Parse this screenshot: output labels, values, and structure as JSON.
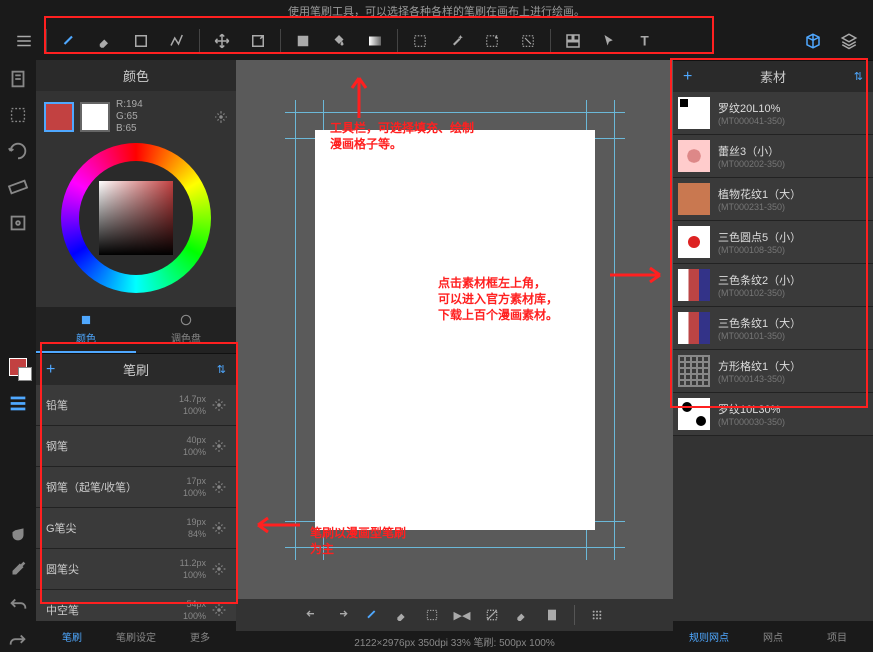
{
  "top_tip": "使用笔刷工具，可以选择各种各样的笔刷在画布上进行绘画。",
  "left_panel": {
    "color_title": "颜色",
    "rgb": {
      "r": "R:194",
      "g": "G:65",
      "b": "B:65"
    },
    "tabs": {
      "color": "颜色",
      "palette": "调色盘"
    },
    "brush_title": "笔刷",
    "brushes": [
      {
        "name": "铅笔",
        "size": "14.7px",
        "opacity": "100%"
      },
      {
        "name": "钢笔",
        "size": "40px",
        "opacity": "100%"
      },
      {
        "name": "钢笔（起笔/收笔）",
        "size": "17px",
        "opacity": "100%"
      },
      {
        "name": "G笔尖",
        "size": "19px",
        "opacity": "84%"
      },
      {
        "name": "圆笔尖",
        "size": "11.2px",
        "opacity": "100%"
      },
      {
        "name": "中空笔",
        "size": "54px",
        "opacity": "100%"
      }
    ],
    "bottom_tabs": {
      "brush": "笔刷",
      "settings": "笔刷设定",
      "more": "更多"
    }
  },
  "right_panel": {
    "title": "素材",
    "materials": [
      {
        "name": "罗纹20L10%",
        "id": "(MT000041-350)"
      },
      {
        "name": "蕾丝3（小）",
        "id": "(MT000202-350)"
      },
      {
        "name": "植物花纹1（大）",
        "id": "(MT000231-350)"
      },
      {
        "name": "三色圆点5（小）",
        "id": "(MT000108-350)"
      },
      {
        "name": "三色条纹2（小）",
        "id": "(MT000102-350)"
      },
      {
        "name": "三色条纹1（大）",
        "id": "(MT000101-350)"
      },
      {
        "name": "方形格纹1（大）",
        "id": "(MT000143-350)"
      },
      {
        "name": "罗纹10L30%",
        "id": "(MT000030-350)"
      }
    ],
    "bottom_tabs": {
      "grid": "规则网点",
      "dots": "网点",
      "project": "项目"
    }
  },
  "status_bar": "2122×2976px 350dpi 33% 笔刷: 500px 100%",
  "annotations": {
    "toolbar": "工具栏，可选择填充、绘制\n漫画格子等。",
    "material": "点击素材框左上角，\n可以进入官方素材库，\n下载上百个漫画素材。",
    "brush": "笔刷以漫画型笔刷\n为主"
  }
}
